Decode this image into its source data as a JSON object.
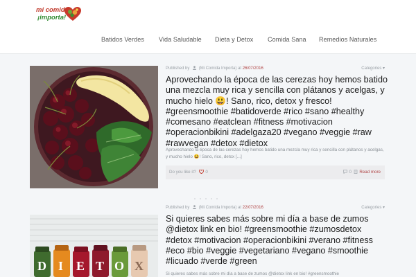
{
  "brand": {
    "line1": "mi comida",
    "line2": "¡importa!"
  },
  "nav": {
    "items": [
      {
        "label": "Batidos Verdes"
      },
      {
        "label": "Vida Saludable"
      },
      {
        "label": "Dieta y Detox"
      },
      {
        "label": "Comida Sana"
      },
      {
        "label": "Remedios Naturales"
      }
    ]
  },
  "posts": [
    {
      "published_by": "Published by",
      "author": "(Mi Comida Importa)",
      "at": "at",
      "date": "26/07/2016",
      "categories": "Categories",
      "title": "Aprovechando la época de las cerezas hoy hemos batido una mezcla muy rica y sencilla con plátanos y acelgas, y mucho hielo 😃! Sano, rico, detox y fresco! #greensmoothie #batidoverde #rico #sano #healthy #comesano #eatclean #fitness #motivacion #operacionbikini #adelgaza20 #vegano #veggie #raw #rawvegan #detox #dietox",
      "excerpt": "Aprovechando la época de las cerezas hoy hemos batido una mezcla muy rica y sencilla con plátanos y acelgas, y mucho hielo 😃! Sano, rico, detox [...]",
      "like_text": "Do you like it?",
      "likes": "0",
      "comments": "0",
      "read_more": "Read more"
    },
    {
      "published_by": "Published by",
      "author": "(Mi Comida Importa)",
      "at": "at",
      "date": "22/07/2016",
      "categories": "Categories",
      "title": "Si quieres sabes más sobre mi día a base de zumos @dietox link en bio! #greensmoothie #zumosdetox #detox #motivacion #operacionbikini #verano #fitness #eco #bio #veggie #vegetariano #vegano #smoothie #licuado #verde #green",
      "excerpt": "Si quieres sabes más sobre mi día a base de zumos @dietox link en bio! #greensmoothie"
    }
  ],
  "colors": {
    "accent": "#b04444",
    "background": "#f4f6f8",
    "header": "#ffffff"
  }
}
